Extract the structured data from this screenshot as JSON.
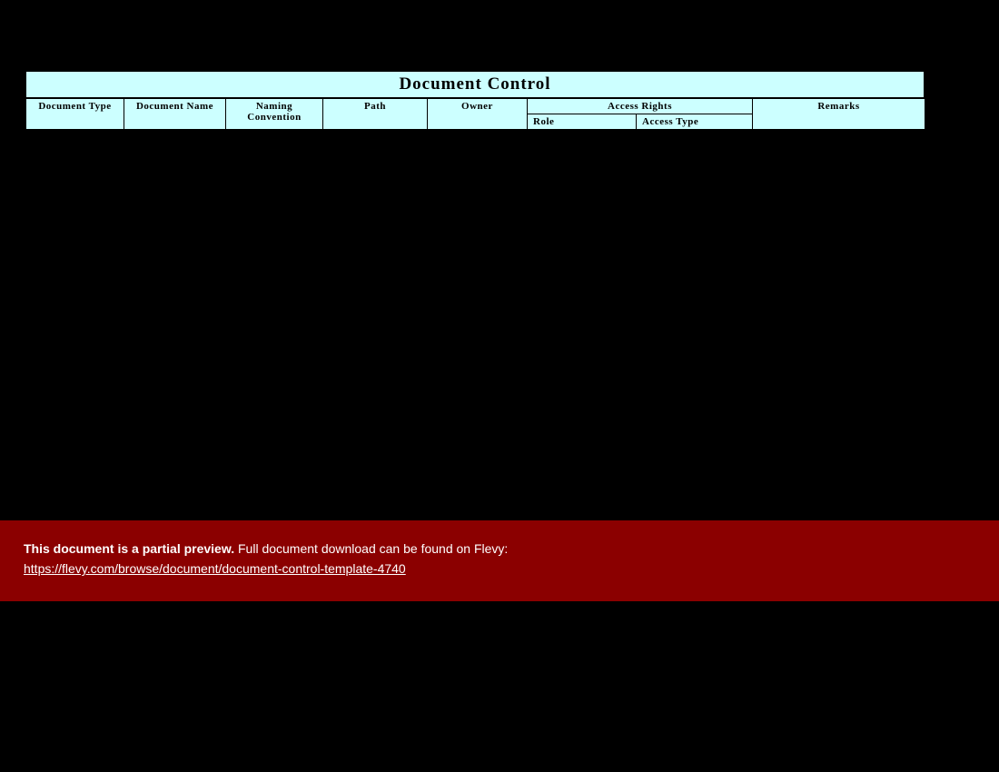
{
  "table": {
    "title": "Document Control",
    "headers": {
      "document_type": "Document Type",
      "document_name": "Document Name",
      "naming_convention": "Naming Convention",
      "path": "Path",
      "owner": "Owner",
      "access_rights": "Access Rights",
      "role": "Role",
      "access_type": "Access Type",
      "remarks": "Remarks"
    }
  },
  "banner": {
    "bold_text": "This document is a partial preview.",
    "following_text": "  Full document download can be found on Flevy:",
    "link_text": "https://flevy.com/browse/document/document-control-template-4740"
  }
}
